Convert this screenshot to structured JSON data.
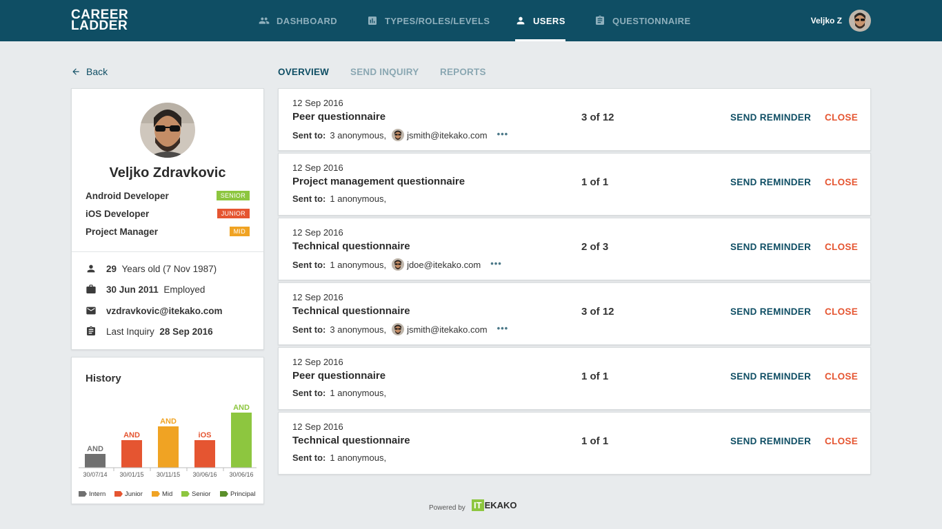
{
  "app": {
    "logo_line1": "CAREER",
    "logo_line2": "LADDER"
  },
  "nav": [
    {
      "label": "DASHBOARD",
      "icon": "people-icon"
    },
    {
      "label": "TYPES/ROLES/LEVELS",
      "icon": "chart-icon"
    },
    {
      "label": "USERS",
      "icon": "person-icon",
      "active": true
    },
    {
      "label": "QUESTIONNAIRE",
      "icon": "clipboard-icon"
    }
  ],
  "current_user": {
    "name": "Veljko Z"
  },
  "back_label": "Back",
  "profile": {
    "name": "Veljko Zdravkovic",
    "roles": [
      {
        "label": "Android Developer",
        "level": "SENIOR",
        "color": "#8dc63f"
      },
      {
        "label": "iOS Developer",
        "level": "JUNIOR",
        "color": "#e55531"
      },
      {
        "label": "Project Manager",
        "level": "MID",
        "color": "#f0a323"
      }
    ],
    "age": "29",
    "age_suffix": "Years old (7 Nov 1987)",
    "employed_date": "30 Jun 2011",
    "employed_label": "Employed",
    "email": "vzdravkovic@itekako.com",
    "last_inquiry_label": "Last Inquiry",
    "last_inquiry_date": "28 Sep 2016"
  },
  "history": {
    "title": "History",
    "chart_data": {
      "type": "bar",
      "categories": [
        "30/07/14",
        "30/01/15",
        "30/11/15",
        "30/06/16",
        "30/06/16"
      ],
      "bar_labels": [
        "AND",
        "AND",
        "AND",
        "iOS",
        "AND"
      ],
      "levels": [
        "Intern",
        "Junior",
        "Mid",
        "Junior",
        "Senior"
      ],
      "values": [
        1,
        2,
        3,
        2,
        4
      ],
      "ylim": [
        0,
        4
      ],
      "legend": [
        {
          "name": "Intern",
          "color": "#707070"
        },
        {
          "name": "Junior",
          "color": "#e55531"
        },
        {
          "name": "Mid",
          "color": "#f0a323"
        },
        {
          "name": "Senior",
          "color": "#8dc63f"
        },
        {
          "name": "Principal",
          "color": "#5a8f2a"
        }
      ],
      "legend_position": "bottom"
    }
  },
  "tabs": [
    {
      "label": "OVERVIEW",
      "active": true
    },
    {
      "label": "SEND INQUIRY"
    },
    {
      "label": "REPORTS"
    }
  ],
  "inquiries": [
    {
      "date": "12 Sep 2016",
      "title": "Peer questionnaire",
      "sent_label": "Sent to:",
      "anon": "3 anonymous,",
      "email": "jsmith@itekako.com",
      "more": "•••",
      "count": "3 of 12",
      "remind": "SEND REMINDER",
      "close": "CLOSE"
    },
    {
      "date": "12 Sep 2016",
      "title": "Project management questionnaire",
      "sent_label": "Sent to:",
      "anon": "1 anonymous,",
      "email": "",
      "more": "",
      "count": "1 of 1",
      "remind": "SEND REMINDER",
      "close": "CLOSE"
    },
    {
      "date": "12 Sep 2016",
      "title": "Technical questionnaire",
      "sent_label": "Sent to:",
      "anon": "1 anonymous,",
      "email": "jdoe@itekako.com",
      "more": "•••",
      "count": "2 of 3",
      "remind": "SEND REMINDER",
      "close": "CLOSE"
    },
    {
      "date": "12 Sep 2016",
      "title": "Technical questionnaire",
      "sent_label": "Sent to:",
      "anon": "3 anonymous,",
      "email": "jsmith@itekako.com",
      "more": "•••",
      "count": "3 of 12",
      "remind": "SEND REMINDER",
      "close": "CLOSE"
    },
    {
      "date": "12 Sep 2016",
      "title": "Peer questionnaire",
      "sent_label": "Sent to:",
      "anon": "1 anonymous,",
      "email": "",
      "more": "",
      "count": "1 of 1",
      "remind": "SEND REMINDER",
      "close": "CLOSE"
    },
    {
      "date": "12 Sep 2016",
      "title": "Technical questionnaire",
      "sent_label": "Sent to:",
      "anon": "1 anonymous,",
      "email": "",
      "more": "",
      "count": "1 of 1",
      "remind": "SEND REMINDER",
      "close": "CLOSE"
    }
  ],
  "footer": {
    "powered_by": "Powered by",
    "brand_box": "IT",
    "brand_rest": "EKAKO"
  }
}
